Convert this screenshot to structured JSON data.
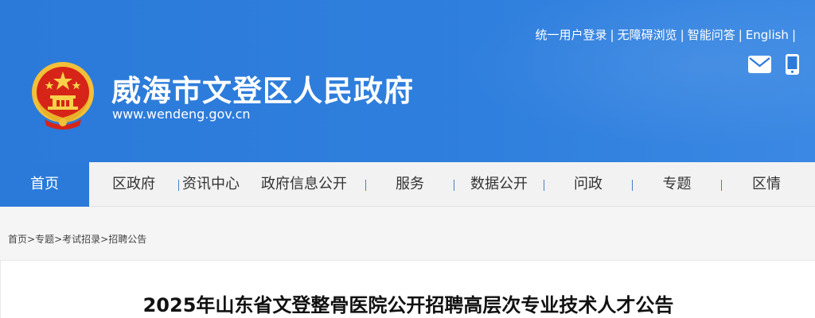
{
  "header": {
    "site_title": "威海市文登区人民政府",
    "site_url": "www.wendeng.gov.cn",
    "top_links": [
      "统一用户登录",
      "无障碍浏览",
      "智能问答",
      "English"
    ],
    "separator": "|",
    "icons": [
      "mail-icon",
      "mobile-phone-icon"
    ],
    "brand_color": "#2b7ad9"
  },
  "nav": {
    "items": [
      "首页",
      "区政府",
      "资讯中心",
      "政府信息公开",
      "服务",
      "数据公开",
      "问政",
      "专题",
      "区情"
    ],
    "active_index": 0
  },
  "breadcrumb": {
    "items": [
      "首页",
      "专题",
      "考试招录",
      "招聘公告"
    ],
    "separator": ">"
  },
  "article": {
    "title": "2025年山东省文登整骨医院公开招聘高层次专业技术人才公告"
  }
}
